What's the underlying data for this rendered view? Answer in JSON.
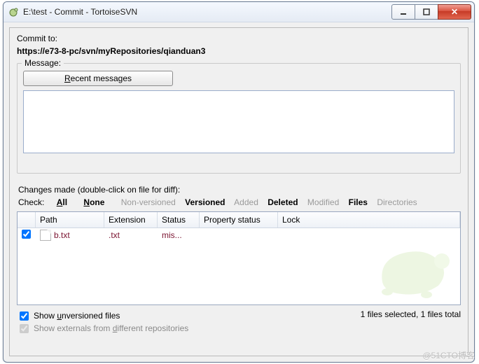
{
  "window": {
    "title": "E:\\test - Commit - TortoiseSVN"
  },
  "commit": {
    "commit_to_label": "Commit to:",
    "url": "https://e73-8-pc/svn/myRepositories/qianduan3",
    "message_label": "Message:",
    "recent_btn_prefix": "R",
    "recent_btn_rest": "ecent messages",
    "message_value": ""
  },
  "changes": {
    "hint": "Changes made (double-click on file for diff):",
    "check_label": "Check:",
    "filters": {
      "all": "All",
      "none": "None",
      "non_versioned": "Non-versioned",
      "versioned": "Versioned",
      "added": "Added",
      "deleted": "Deleted",
      "modified": "Modified",
      "files": "Files",
      "directories": "Directories"
    },
    "columns": {
      "path": "Path",
      "extension": "Extension",
      "status": "Status",
      "property_status": "Property status",
      "lock": "Lock"
    },
    "rows": [
      {
        "checked": true,
        "path": "b.txt",
        "extension": ".txt",
        "status": "mis...",
        "property_status": "",
        "lock": ""
      }
    ],
    "status_text": "1 files selected, 1 files total"
  },
  "options": {
    "show_unversioned_label_pre": "Show ",
    "show_unversioned_label_u": "u",
    "show_unversioned_label_post": "nversioned files",
    "show_unversioned_checked": true,
    "show_externals_label_pre": "Show externals from ",
    "show_externals_label_u": "d",
    "show_externals_label_post": "ifferent repositories",
    "show_externals_checked": true,
    "show_externals_enabled": false
  },
  "watermark": "@51CTO博客"
}
